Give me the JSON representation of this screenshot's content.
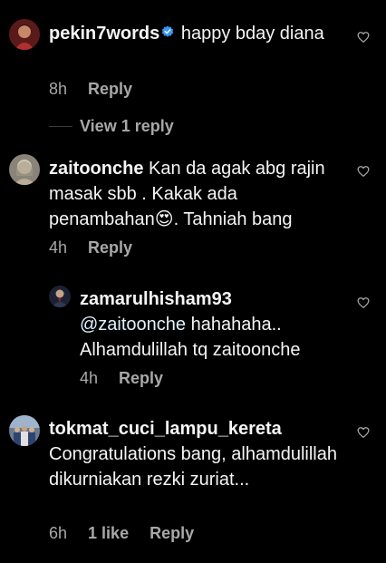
{
  "comments": [
    {
      "username": "pekin7words",
      "verified": true,
      "text": "happy bday diana",
      "time": "8h",
      "reply_label": "Reply",
      "avatar": "avatar-pekin7words"
    },
    {
      "username": "zaitoonche",
      "text": "Kan da agak abg rajin masak sbb . Kakak ada penambahan",
      "emoji": "😍",
      "text_after": ". Tahniah bang",
      "time": "4h",
      "reply_label": "Reply",
      "avatar": "avatar-zaitoonche"
    },
    {
      "username": "tokmat_cuci_lampu_kereta",
      "text": "Congratulations bang, alhamdulillah dikurniakan rezki zuriat...",
      "time": "6h",
      "likes": "1 like",
      "reply_label": "Reply",
      "avatar": "avatar-tokmat"
    }
  ],
  "view_replies": {
    "label": "View 1 reply"
  },
  "reply": {
    "username": "zamarulhisham93",
    "mention": "@zaitoonche",
    "text": "hahahaha.. Alhamdulillah tq zaitoonche",
    "time": "4h",
    "reply_label": "Reply",
    "avatar": "avatar-zamarulhisham93"
  },
  "icons": {
    "like": "heart-outline-icon",
    "verified": "verified-badge-icon"
  },
  "colors": {
    "background": "#000000",
    "text": "#f5f5f5",
    "secondary_text": "#a8a8a8",
    "verified_blue": "#3897f0",
    "mention": "#e0f1ff"
  }
}
